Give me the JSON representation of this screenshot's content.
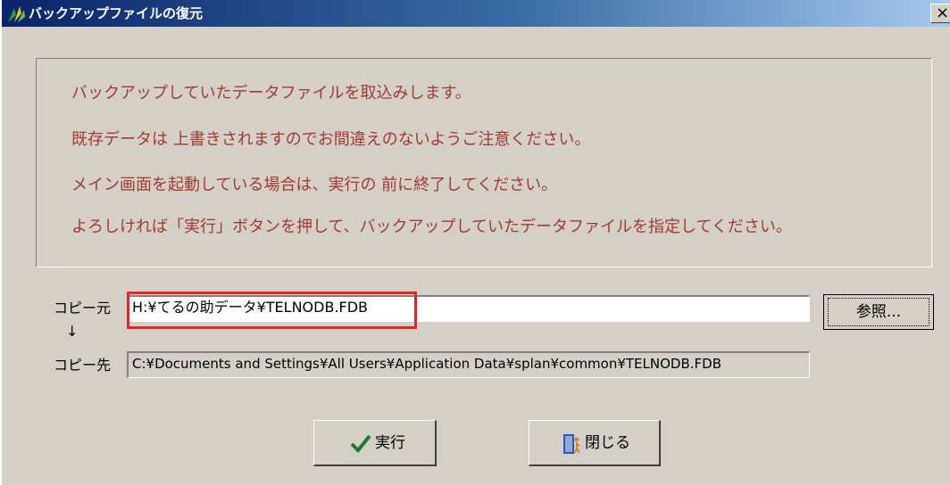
{
  "window": {
    "title": "バックアップファイルの復元",
    "close_label": "×"
  },
  "messages": [
    "バックアップしていたデータファイルを取込みします。",
    "既存データは 上書きされますのでお間違えのないようご注意ください。",
    "メイン画面を起動している場合は、実行の 前に終了してください。",
    "よろしければ「実行」ボタンを押して、バックアップしていたデータファイルを指定してください。"
  ],
  "source": {
    "label": "コピー元",
    "value": "H:¥てるの助データ¥TELNODB.FDB",
    "browse_label": "参照..."
  },
  "arrow": "↓",
  "destination": {
    "label": "コピー先",
    "value": "C:¥Documents and Settings¥All Users¥Application Data¥splan¥common¥TELNODB.FDB"
  },
  "buttons": {
    "run_label": "実行",
    "close_label": "閉じる"
  },
  "colors": {
    "message_text": "#a33a2e",
    "highlight_border": "#e8222a",
    "title_bar": "#0a246a"
  }
}
